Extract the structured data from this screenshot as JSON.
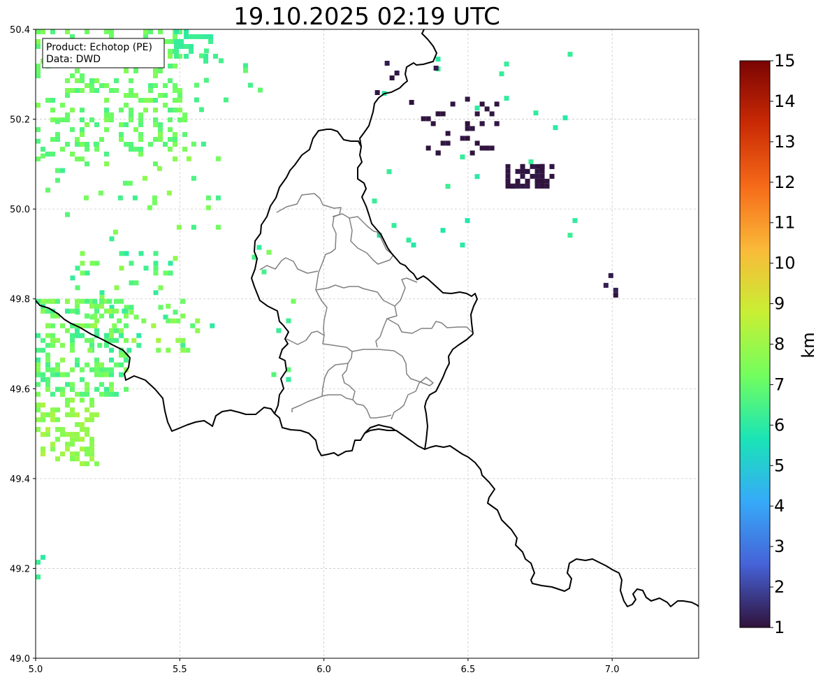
{
  "title": "19.10.2025 02:19 UTC",
  "info_box": {
    "product_line": "Product: Echotop (PE)",
    "data_line": "Data: DWD"
  },
  "map": {
    "lon_range": [
      5.0,
      7.3
    ],
    "lat_range": [
      49.0,
      50.4
    ],
    "x_ticks": [
      {
        "value": 5.0,
        "label": "5.0"
      },
      {
        "value": 5.5,
        "label": "5.5"
      },
      {
        "value": 6.0,
        "label": "6.0"
      },
      {
        "value": 6.5,
        "label": "6.5"
      },
      {
        "value": 7.0,
        "label": "7.0"
      }
    ],
    "y_ticks": [
      {
        "value": 49.0,
        "label": "49.0"
      },
      {
        "value": 49.2,
        "label": "49.2"
      },
      {
        "value": 49.4,
        "label": "49.4"
      },
      {
        "value": 49.6,
        "label": "49.6"
      },
      {
        "value": 49.8,
        "label": "49.8"
      },
      {
        "value": 50.0,
        "label": "50.0"
      },
      {
        "value": 50.2,
        "label": "50.2"
      },
      {
        "value": 50.4,
        "label": "50.4"
      }
    ],
    "grid": true,
    "country_border_color": "#000000",
    "district_border_color": "#808080",
    "radar_clusters": [
      {
        "lon": [
          5.0,
          5.52
        ],
        "lat": [
          50.1,
          50.4
        ],
        "count": 260,
        "value": [
          6.5,
          7.6
        ]
      },
      {
        "lon": [
          5.48,
          5.63
        ],
        "lat": [
          50.33,
          50.4
        ],
        "count": 25,
        "value": [
          6.0,
          6.4
        ]
      },
      {
        "lon": [
          5.55,
          5.85
        ],
        "lat": [
          50.2,
          50.39
        ],
        "count": 12,
        "value": [
          6.3,
          7.0
        ]
      },
      {
        "lon": [
          5.15,
          5.65
        ],
        "lat": [
          49.95,
          50.15
        ],
        "count": 25,
        "value": [
          6.3,
          7.8
        ]
      },
      {
        "lon": [
          5.0,
          5.12
        ],
        "lat": [
          49.95,
          50.2
        ],
        "count": 8,
        "value": [
          6.3,
          7.2
        ]
      },
      {
        "lon": [
          5.12,
          5.5
        ],
        "lat": [
          49.75,
          49.95
        ],
        "count": 45,
        "value": [
          6.0,
          7.8
        ]
      },
      {
        "lon": [
          5.0,
          5.32
        ],
        "lat": [
          49.58,
          49.8
        ],
        "count": 210,
        "value": [
          6.2,
          7.8
        ]
      },
      {
        "lon": [
          5.0,
          5.22
        ],
        "lat": [
          49.43,
          49.58
        ],
        "count": 90,
        "value": [
          7.3,
          8.4
        ]
      },
      {
        "lon": [
          5.18,
          5.62
        ],
        "lat": [
          49.68,
          49.8
        ],
        "count": 35,
        "value": [
          6.0,
          8.2
        ]
      },
      {
        "lon": [
          5.75,
          5.92
        ],
        "lat": [
          49.62,
          49.92
        ],
        "count": 10,
        "value": [
          6.0,
          7.5
        ]
      },
      {
        "lon": [
          5.0,
          5.05
        ],
        "lat": [
          49.17,
          49.23
        ],
        "count": 3,
        "value": [
          5.9,
          6.3
        ]
      },
      {
        "lon": [
          6.15,
          6.9
        ],
        "lat": [
          49.9,
          50.35
        ],
        "count": 26,
        "value": [
          5.8,
          6.3
        ]
      },
      {
        "lon": [
          6.63,
          6.79
        ],
        "lat": [
          50.05,
          50.1
        ],
        "count": 45,
        "value": [
          1.0,
          1.1
        ]
      },
      {
        "lon": [
          6.32,
          6.6
        ],
        "lat": [
          50.12,
          50.25
        ],
        "count": 35,
        "value": [
          1.0,
          1.1
        ]
      },
      {
        "lon": [
          6.16,
          6.41
        ],
        "lat": [
          50.22,
          50.33
        ],
        "count": 6,
        "value": [
          1.0,
          1.3
        ]
      },
      {
        "lon": [
          6.97,
          7.02
        ],
        "lat": [
          49.8,
          49.89
        ],
        "count": 4,
        "value": [
          1.0,
          1.3
        ]
      }
    ]
  },
  "colorbar": {
    "label": "km",
    "min": 1,
    "max": 15,
    "tick_labels": [
      "1",
      "2",
      "3",
      "4",
      "5",
      "6",
      "7",
      "8",
      "9",
      "10",
      "11",
      "12",
      "13",
      "14",
      "15"
    ],
    "colormap": "turbo",
    "stops": [
      "#30123b",
      "#4662d7",
      "#36aaf9",
      "#1ae4b6",
      "#72fe5e",
      "#c8ef34",
      "#faba39",
      "#f66b19",
      "#ca2a04",
      "#7a0403"
    ]
  }
}
